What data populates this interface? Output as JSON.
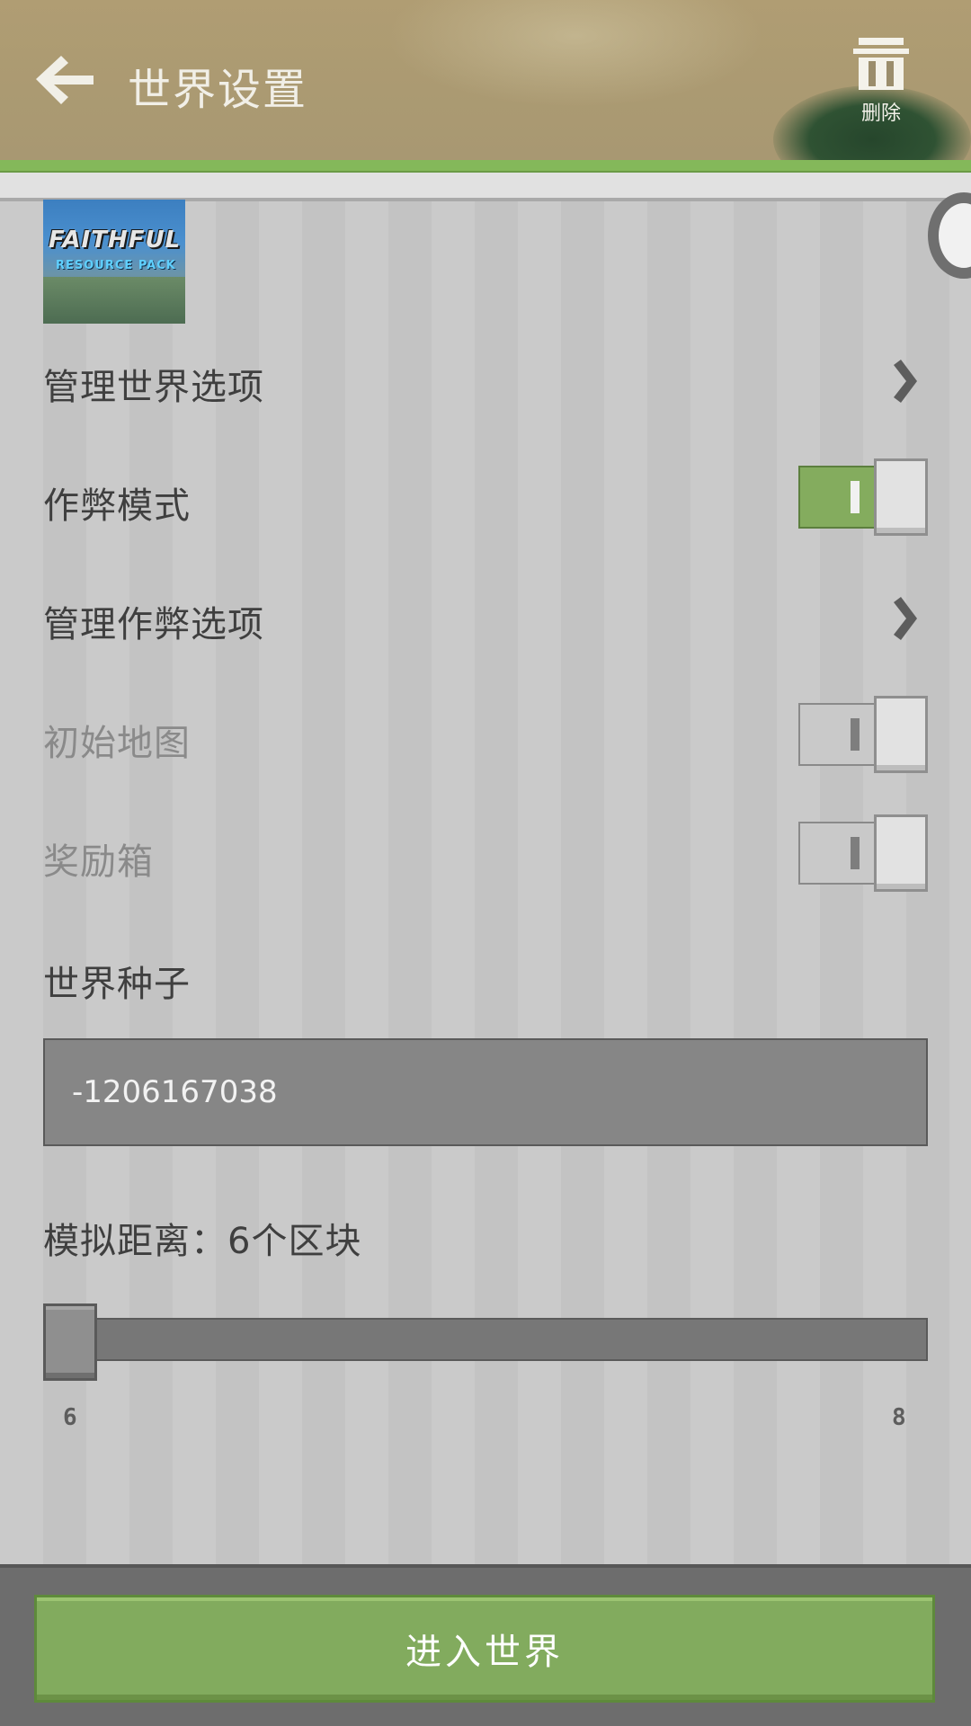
{
  "header": {
    "title": "世界设置",
    "back_icon": "arrow-left-icon",
    "delete_icon": "trash-icon",
    "delete_label": "删除"
  },
  "thumbnail": {
    "logo_text": "FAITHFUL",
    "logo_subtext": "RESOURCE PACK"
  },
  "settings": {
    "manage_world": {
      "label": "管理世界选项"
    },
    "cheats": {
      "label": "作弊模式",
      "enabled": true
    },
    "manage_cheats": {
      "label": "管理作弊选项"
    },
    "starting_map": {
      "label": "初始地图",
      "enabled": false
    },
    "bonus_chest": {
      "label": "奖励箱",
      "enabled": false
    },
    "seed": {
      "label": "世界种子",
      "value": "-1206167038"
    },
    "simulation": {
      "label": "模拟距离：6个区块",
      "value": 6,
      "min_label": "6",
      "max_label": "8"
    }
  },
  "footer": {
    "enter_label": "进入世界"
  },
  "colors": {
    "accent_green": "#82ab5e",
    "header_tan": "#b09d73"
  }
}
